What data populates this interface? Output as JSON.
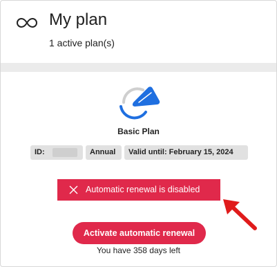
{
  "header": {
    "icon": "infinity-icon",
    "title": "My plan",
    "subtitle": "1 active plan(s)"
  },
  "plan": {
    "logo": "plan-logo-icon",
    "name": "Basic Plan",
    "tags": {
      "id_label": "ID:",
      "billing": "Annual",
      "valid_until": "Valid until: February 15, 2024"
    }
  },
  "renewal": {
    "icon": "close-icon",
    "status_text": "Automatic renewal is disabled",
    "button_label": "Activate automatic renewal",
    "days_left": "You have 358 days left"
  },
  "colors": {
    "accent": "#e0294b",
    "logo_blue": "#1f6fe0",
    "tag_bg": "#e1e1e1",
    "band": "#ebebeb"
  }
}
